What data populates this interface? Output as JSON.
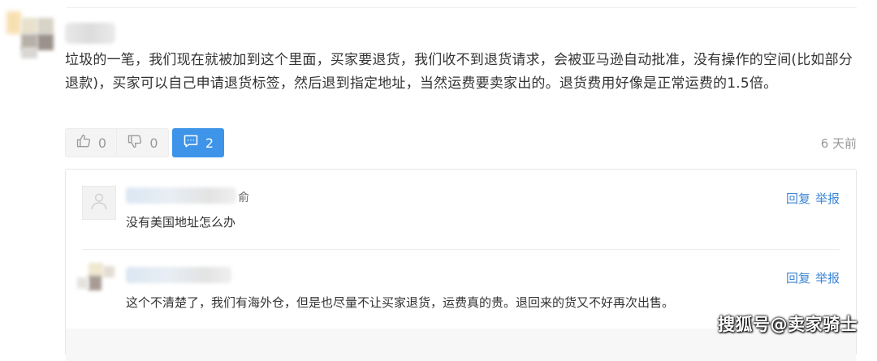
{
  "comment": {
    "text": "垃圾的一笔，我们现在就被加到这个里面，买家要退货，我们收不到退货请求，会被亚马逊自动批准，没有操作的空间(比如部分退款)，买家可以自己申请退货标签，然后退到指定地址，当然运费要卖家出的。退货费用好像是正常运费的1.5倍。",
    "likes": "0",
    "dislikes": "0",
    "reply_count": "2",
    "time_ago": "6 天前",
    "icons": {
      "like": "thumbs-up-icon",
      "dislike": "thumbs-down-icon",
      "replies": "comment-bubble-icon"
    },
    "accent_color": "#3d94e8"
  },
  "replies": [
    {
      "name_tail": "俞",
      "text": "没有美国地址怎么办",
      "reply_label": "回复",
      "report_label": "举报"
    },
    {
      "text": "这个不清楚了，我们有海外仓，但是也尽量不让买家退货，运费真的贵。退回来的货又不好再次出售。",
      "reply_label": "回复",
      "report_label": "举报"
    }
  ],
  "watermark": "搜狐号@卖家骑士"
}
